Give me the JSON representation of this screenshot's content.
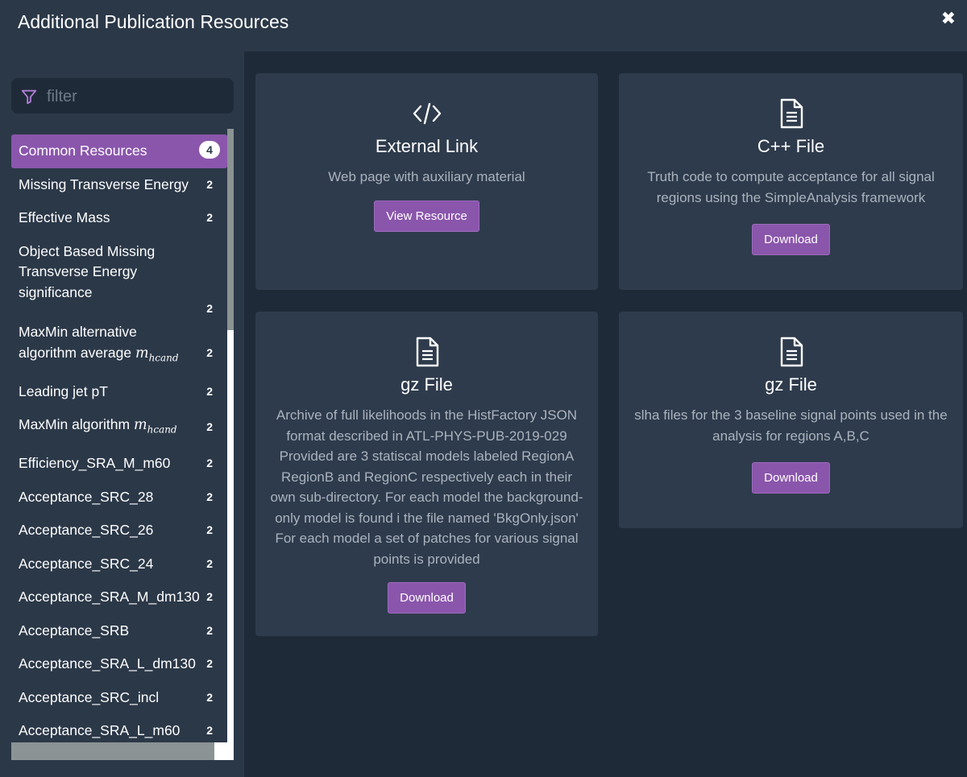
{
  "header": {
    "title": "Additional Publication Resources",
    "close_symbol": "✖"
  },
  "filter": {
    "placeholder": "filter",
    "value": ""
  },
  "sidebar": {
    "items": [
      {
        "label": "Common Resources",
        "count": "4",
        "active": true
      },
      {
        "label": "Missing Transverse Energy",
        "count": "2"
      },
      {
        "label": "Effective Mass",
        "count": "2"
      },
      {
        "label": "Object Based Missing Transverse Energy significance",
        "count": "2"
      },
      {
        "label": "MaxMin alternative algorithm average",
        "math": "m",
        "math_sub": "hcand",
        "count": "2"
      },
      {
        "label": "Leading jet pT",
        "count": "2"
      },
      {
        "label": "MaxMin algorithm",
        "math": "m",
        "math_sub": "hcand",
        "count": "2"
      },
      {
        "label": "Efficiency_SRA_M_m60",
        "count": "2"
      },
      {
        "label": "Acceptance_SRC_28",
        "count": "2"
      },
      {
        "label": "Acceptance_SRC_26",
        "count": "2"
      },
      {
        "label": "Acceptance_SRC_24",
        "count": "2"
      },
      {
        "label": "Acceptance_SRA_M_dm130",
        "count": "2"
      },
      {
        "label": "Acceptance_SRB",
        "count": "2"
      },
      {
        "label": "Acceptance_SRA_L_dm130",
        "count": "2"
      },
      {
        "label": "Acceptance_SRC_incl",
        "count": "2"
      },
      {
        "label": "Acceptance_SRA_L_m60",
        "count": "2"
      }
    ]
  },
  "cards": [
    {
      "icon": "code-icon",
      "title": "External Link",
      "description": "Web page with auxiliary material",
      "button": "View Resource"
    },
    {
      "icon": "file-icon",
      "title": "C++ File",
      "description": "Truth code to compute acceptance for all signal regions using the SimpleAnalysis framework",
      "button": "Download"
    },
    {
      "icon": "file-icon",
      "title": "gz File",
      "description": "Archive of full likelihoods in the HistFactory JSON format described in ATL-PHYS-PUB-2019-029 Provided are 3 statiscal models labeled RegionA RegionB and RegionC respectively each in their own sub-directory. For each model the background-only model is found i the file named 'BkgOnly.json' For each model a set of patches for various signal points is provided",
      "button": "Download"
    },
    {
      "icon": "file-icon",
      "title": "gz File",
      "description": "slha files for the 3 baseline signal points used in the analysis for regions A,B,C",
      "button": "Download"
    }
  ],
  "colors": {
    "accent": "#8a56ac",
    "background": "#1f2a38",
    "panel": "#2b3848",
    "card": "#2e3b4c"
  }
}
